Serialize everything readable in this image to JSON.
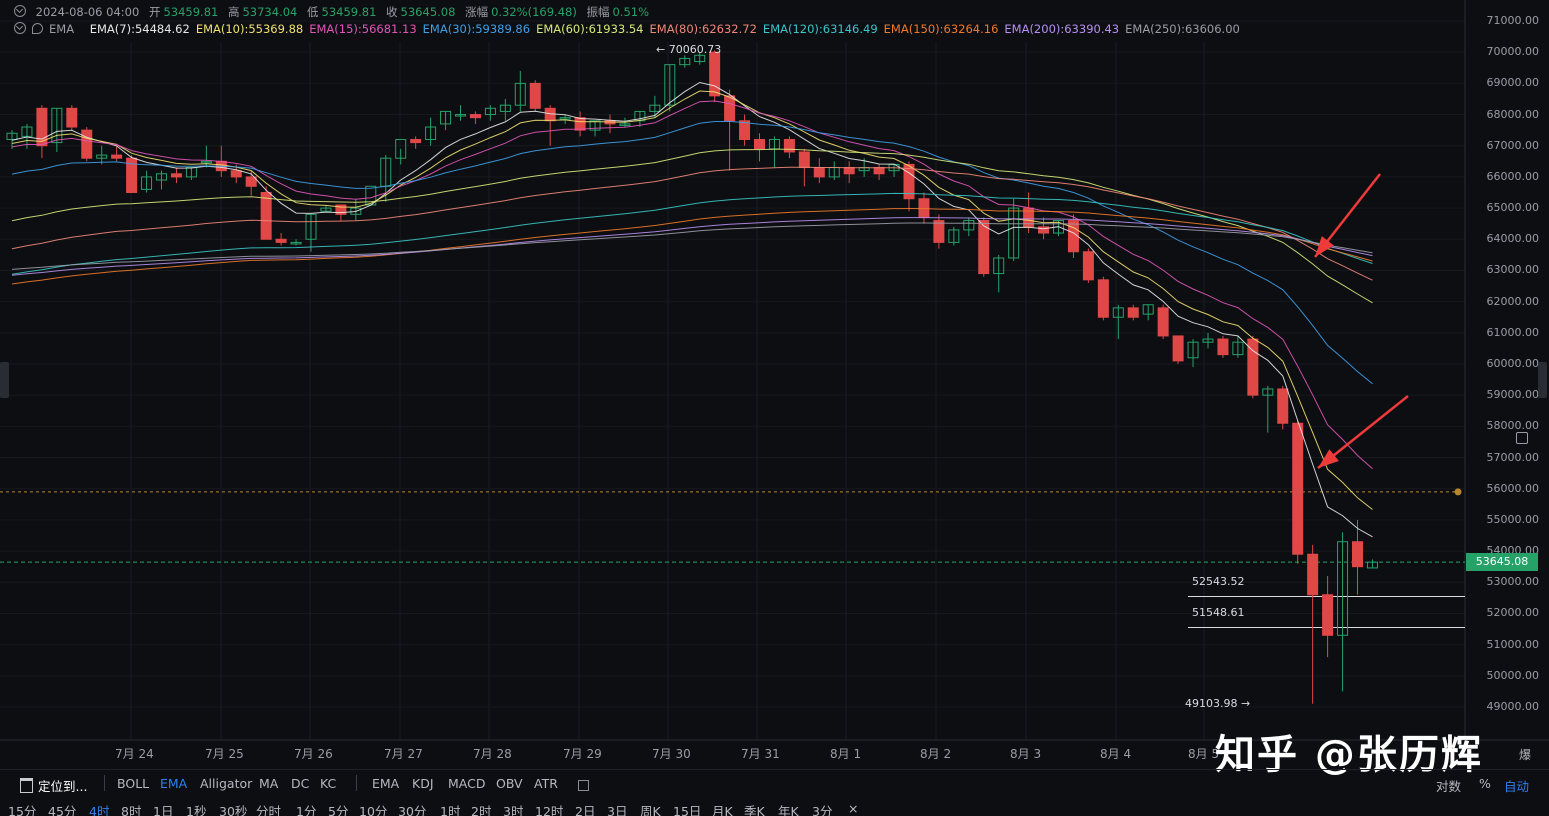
{
  "header": {
    "row1": {
      "datetime": "2024-08-06 04:00",
      "open_label": "开",
      "open": "53459.81",
      "high_label": "高",
      "high": "53734.04",
      "low_label": "低",
      "low": "53459.81",
      "close_label": "收",
      "close": "53645.08",
      "change_label": "涨幅",
      "change": "0.32%(169.48)",
      "amp_label": "振幅",
      "amp": "0.51%"
    },
    "row2": {
      "indicator": "EMA",
      "emas": [
        {
          "text": "EMA(7):54484.62",
          "color": "#e8e8e8"
        },
        {
          "text": "EMA(10):55369.88",
          "color": "#f0e070"
        },
        {
          "text": "EMA(15):56681.13",
          "color": "#e056b8"
        },
        {
          "text": "EMA(30):59389.86",
          "color": "#3ea0e8"
        },
        {
          "text": "EMA(60):61933.54",
          "color": "#d8e87a"
        },
        {
          "text": "EMA(80):62632.72",
          "color": "#f08878"
        },
        {
          "text": "EMA(120):63146.49",
          "color": "#39c6c6"
        },
        {
          "text": "EMA(150):63264.16",
          "color": "#f07a2a"
        },
        {
          "text": "EMA(200):63390.43",
          "color": "#b890f0"
        },
        {
          "text": "EMA(250):63606.00",
          "color": "#9a9da6"
        }
      ]
    }
  },
  "price_axis": [
    "71000.00",
    "70000.00",
    "69000.00",
    "68000.00",
    "67000.00",
    "66000.00",
    "65000.00",
    "64000.00",
    "63000.00",
    "62000.00",
    "61000.00",
    "60000.00",
    "59000.00",
    "58000.00",
    "57000.00",
    "56000.00",
    "55000.00",
    "54000.00",
    "53000.00",
    "52000.00",
    "51000.00",
    "50000.00",
    "49000.00"
  ],
  "current_price": "53645.08",
  "annotations": {
    "high": "← 70060.73",
    "low": "49103.98 →",
    "level1": "52543.52",
    "level2": "51548.61"
  },
  "date_axis": [
    "7月 24",
    "7月 25",
    "7月 26",
    "7月 27",
    "7月 28",
    "7月 29",
    "7月 30",
    "7月 31",
    "8月 1",
    "8月 2",
    "8月 3",
    "8月 4",
    "8月 5"
  ],
  "watermark": "知乎 @张历辉",
  "toolbar": {
    "locate": "定位到...",
    "main_indicators": [
      "BOLL",
      "EMA",
      "Alligator",
      "MA",
      "DC",
      "KC"
    ],
    "active_main": "EMA",
    "sub_indicators": [
      "EMA",
      "KDJ",
      "MACD",
      "OBV",
      "ATR"
    ],
    "right": {
      "log": "对数",
      "pct": "%",
      "auto": "自动"
    },
    "corner": "爆"
  },
  "intervals": {
    "items": [
      "15分",
      "45分",
      "4时",
      "8时",
      "1日",
      "1秒",
      "30秒",
      "分时",
      "1分",
      "5分",
      "10分",
      "30分",
      "1时",
      "2时",
      "3时",
      "12时",
      "2日",
      "3日",
      "周K",
      "15日",
      "月K",
      "季K",
      "年K",
      "3分"
    ],
    "active": "4时",
    "close": "×"
  },
  "colors": {
    "up": "#26a269",
    "down": "#e04848",
    "accent": "#2f7ff0",
    "bg": "#0d0e12"
  },
  "chart_data": {
    "type": "candlestick",
    "interval": "4时",
    "ylim": [
      49000,
      71000
    ],
    "x": [
      "7月 24",
      "7月 25",
      "7月 26",
      "7月 27",
      "7月 28",
      "7月 29",
      "7月 30",
      "7月 31",
      "8月 1",
      "8月 2",
      "8月 3",
      "8月 4",
      "8月 5"
    ],
    "candles": [
      {
        "o": 67200,
        "h": 67500,
        "c": 67400,
        "l": 66900
      },
      {
        "o": 67300,
        "h": 67700,
        "c": 67600,
        "l": 66900
      },
      {
        "o": 68200,
        "h": 68300,
        "c": 67000,
        "l": 66600
      },
      {
        "o": 67100,
        "h": 68200,
        "c": 68200,
        "l": 66800
      },
      {
        "o": 68200,
        "h": 68300,
        "c": 67600,
        "l": 67500
      },
      {
        "o": 67500,
        "h": 67600,
        "c": 66600,
        "l": 66500
      },
      {
        "o": 66600,
        "h": 67000,
        "c": 66700,
        "l": 66400
      },
      {
        "o": 66700,
        "h": 67000,
        "c": 66600,
        "l": 66500
      },
      {
        "o": 66600,
        "h": 66700,
        "c": 65500,
        "l": 65500
      },
      {
        "o": 65600,
        "h": 66200,
        "c": 66000,
        "l": 65500
      },
      {
        "o": 65900,
        "h": 66200,
        "c": 66100,
        "l": 65600
      },
      {
        "o": 66100,
        "h": 66300,
        "c": 66000,
        "l": 65800
      },
      {
        "o": 66000,
        "h": 66300,
        "c": 66300,
        "l": 65900
      },
      {
        "o": 66500,
        "h": 67000,
        "c": 66500,
        "l": 66300
      },
      {
        "o": 66500,
        "h": 67000,
        "c": 66200,
        "l": 66000
      },
      {
        "o": 66200,
        "h": 66400,
        "c": 66000,
        "l": 65800
      },
      {
        "o": 66000,
        "h": 66200,
        "c": 65700,
        "l": 65400
      },
      {
        "o": 65500,
        "h": 65700,
        "c": 64000,
        "l": 64000
      },
      {
        "o": 64000,
        "h": 64200,
        "c": 63900,
        "l": 63800
      },
      {
        "o": 63900,
        "h": 64000,
        "c": 63900,
        "l": 63800
      },
      {
        "o": 64000,
        "h": 64800,
        "c": 64800,
        "l": 63600
      },
      {
        "o": 64900,
        "h": 65100,
        "c": 65000,
        "l": 64900
      },
      {
        "o": 65100,
        "h": 65100,
        "c": 64800,
        "l": 64600
      },
      {
        "o": 64800,
        "h": 65300,
        "c": 65000,
        "l": 64600
      },
      {
        "o": 65100,
        "h": 65300,
        "c": 65700,
        "l": 65300
      },
      {
        "o": 65700,
        "h": 66700,
        "c": 66600,
        "l": 65200
      },
      {
        "o": 66600,
        "h": 66900,
        "c": 67200,
        "l": 66400
      },
      {
        "o": 67200,
        "h": 67300,
        "c": 67100,
        "l": 66900
      },
      {
        "o": 67200,
        "h": 67900,
        "c": 67600,
        "l": 67000
      },
      {
        "o": 67700,
        "h": 68100,
        "c": 68100,
        "l": 67500
      },
      {
        "o": 68000,
        "h": 68300,
        "c": 68000,
        "l": 67800
      },
      {
        "o": 68000,
        "h": 68100,
        "c": 67900,
        "l": 67700
      },
      {
        "o": 68000,
        "h": 68300,
        "c": 68200,
        "l": 67800
      },
      {
        "o": 68100,
        "h": 68500,
        "c": 68300,
        "l": 67800
      },
      {
        "o": 68300,
        "h": 69400,
        "c": 69000,
        "l": 68100
      },
      {
        "o": 69000,
        "h": 69100,
        "c": 68200,
        "l": 68100
      },
      {
        "o": 68200,
        "h": 68300,
        "c": 67800,
        "l": 67000
      },
      {
        "o": 67900,
        "h": 68000,
        "c": 67900,
        "l": 67700
      },
      {
        "o": 67900,
        "h": 68100,
        "c": 67500,
        "l": 67300
      },
      {
        "o": 67500,
        "h": 67800,
        "c": 67800,
        "l": 67300
      },
      {
        "o": 67800,
        "h": 68000,
        "c": 67700,
        "l": 67400
      },
      {
        "o": 67700,
        "h": 67900,
        "c": 67700,
        "l": 67600
      },
      {
        "o": 67800,
        "h": 68100,
        "c": 68100,
        "l": 67600
      },
      {
        "o": 68100,
        "h": 68600,
        "c": 68300,
        "l": 67900
      },
      {
        "o": 68300,
        "h": 69600,
        "c": 69600,
        "l": 68100
      },
      {
        "o": 69600,
        "h": 69900,
        "c": 69800,
        "l": 69500
      },
      {
        "o": 69700,
        "h": 70000,
        "c": 69900,
        "l": 69600
      },
      {
        "o": 70000,
        "h": 70061,
        "c": 68600,
        "l": 68400
      },
      {
        "o": 68600,
        "h": 68800,
        "c": 67800,
        "l": 66200
      },
      {
        "o": 67800,
        "h": 68000,
        "c": 67200,
        "l": 67000
      },
      {
        "o": 67200,
        "h": 67400,
        "c": 66900,
        "l": 66500
      },
      {
        "o": 66900,
        "h": 67300,
        "c": 67200,
        "l": 66300
      },
      {
        "o": 67200,
        "h": 67300,
        "c": 66800,
        "l": 66600
      },
      {
        "o": 66800,
        "h": 66900,
        "c": 66300,
        "l": 65700
      },
      {
        "o": 66300,
        "h": 66600,
        "c": 66000,
        "l": 65800
      },
      {
        "o": 66000,
        "h": 66500,
        "c": 66300,
        "l": 65900
      },
      {
        "o": 66300,
        "h": 66500,
        "c": 66100,
        "l": 65800
      },
      {
        "o": 66200,
        "h": 66600,
        "c": 66300,
        "l": 66000
      },
      {
        "o": 66300,
        "h": 66400,
        "c": 66100,
        "l": 65900
      },
      {
        "o": 66200,
        "h": 66400,
        "c": 66400,
        "l": 66000
      },
      {
        "o": 66400,
        "h": 66500,
        "c": 65300,
        "l": 64900
      },
      {
        "o": 65300,
        "h": 65500,
        "c": 64700,
        "l": 64500
      },
      {
        "o": 64600,
        "h": 64800,
        "c": 63900,
        "l": 63700
      },
      {
        "o": 63900,
        "h": 64400,
        "c": 64300,
        "l": 63800
      },
      {
        "o": 64300,
        "h": 64700,
        "c": 64600,
        "l": 64100
      },
      {
        "o": 64600,
        "h": 64700,
        "c": 62900,
        "l": 62800
      },
      {
        "o": 62900,
        "h": 63500,
        "c": 63400,
        "l": 62300
      },
      {
        "o": 63400,
        "h": 65300,
        "c": 65000,
        "l": 63300
      },
      {
        "o": 65000,
        "h": 65500,
        "c": 64400,
        "l": 64200
      },
      {
        "o": 64400,
        "h": 64700,
        "c": 64200,
        "l": 64000
      },
      {
        "o": 64200,
        "h": 64600,
        "c": 64600,
        "l": 64100
      },
      {
        "o": 64600,
        "h": 64800,
        "c": 63600,
        "l": 63400
      },
      {
        "o": 63600,
        "h": 63700,
        "c": 62700,
        "l": 62600
      },
      {
        "o": 62700,
        "h": 62800,
        "c": 61500,
        "l": 61400
      },
      {
        "o": 61500,
        "h": 61900,
        "c": 61800,
        "l": 60800
      },
      {
        "o": 61800,
        "h": 61900,
        "c": 61500,
        "l": 61400
      },
      {
        "o": 61600,
        "h": 61900,
        "c": 61900,
        "l": 61400
      },
      {
        "o": 61800,
        "h": 61900,
        "c": 60900,
        "l": 60800
      },
      {
        "o": 60900,
        "h": 60900,
        "c": 60100,
        "l": 60000
      },
      {
        "o": 60200,
        "h": 60800,
        "c": 60700,
        "l": 59900
      },
      {
        "o": 60700,
        "h": 61000,
        "c": 60800,
        "l": 60500
      },
      {
        "o": 60800,
        "h": 60900,
        "c": 60300,
        "l": 60200
      },
      {
        "o": 60300,
        "h": 60900,
        "c": 60700,
        "l": 60200
      },
      {
        "o": 60800,
        "h": 60900,
        "c": 59000,
        "l": 58900
      },
      {
        "o": 59000,
        "h": 59300,
        "c": 59200,
        "l": 57800
      },
      {
        "o": 59200,
        "h": 59300,
        "c": 58100,
        "l": 57900
      },
      {
        "o": 58100,
        "h": 58200,
        "c": 53900,
        "l": 53600
      },
      {
        "o": 53900,
        "h": 54200,
        "c": 52600,
        "l": 49104
      },
      {
        "o": 52600,
        "h": 53200,
        "c": 51300,
        "l": 50600
      },
      {
        "o": 51300,
        "h": 54600,
        "c": 54300,
        "l": 49500
      },
      {
        "o": 54300,
        "h": 55000,
        "c": 53500,
        "l": 52600
      },
      {
        "o": 53460,
        "h": 53734,
        "c": 53645,
        "l": 53460
      }
    ],
    "ema_lines": [
      {
        "name": "EMA(7)",
        "value": 54484.62
      },
      {
        "name": "EMA(10)",
        "value": 55369.88
      },
      {
        "name": "EMA(15)",
        "value": 56681.13
      },
      {
        "name": "EMA(30)",
        "value": 59389.86
      },
      {
        "name": "EMA(60)",
        "value": 61933.54
      },
      {
        "name": "EMA(80)",
        "value": 62632.72
      },
      {
        "name": "EMA(120)",
        "value": 63146.49
      },
      {
        "name": "EMA(150)",
        "value": 63264.16
      },
      {
        "name": "EMA(200)",
        "value": 63390.43
      },
      {
        "name": "EMA(250)",
        "value": 63606.0
      }
    ],
    "horizontal_levels": [
      55900,
      53645.08,
      52543.52,
      51548.61
    ],
    "extremes": {
      "high": 70060.73,
      "low": 49103.98
    }
  }
}
